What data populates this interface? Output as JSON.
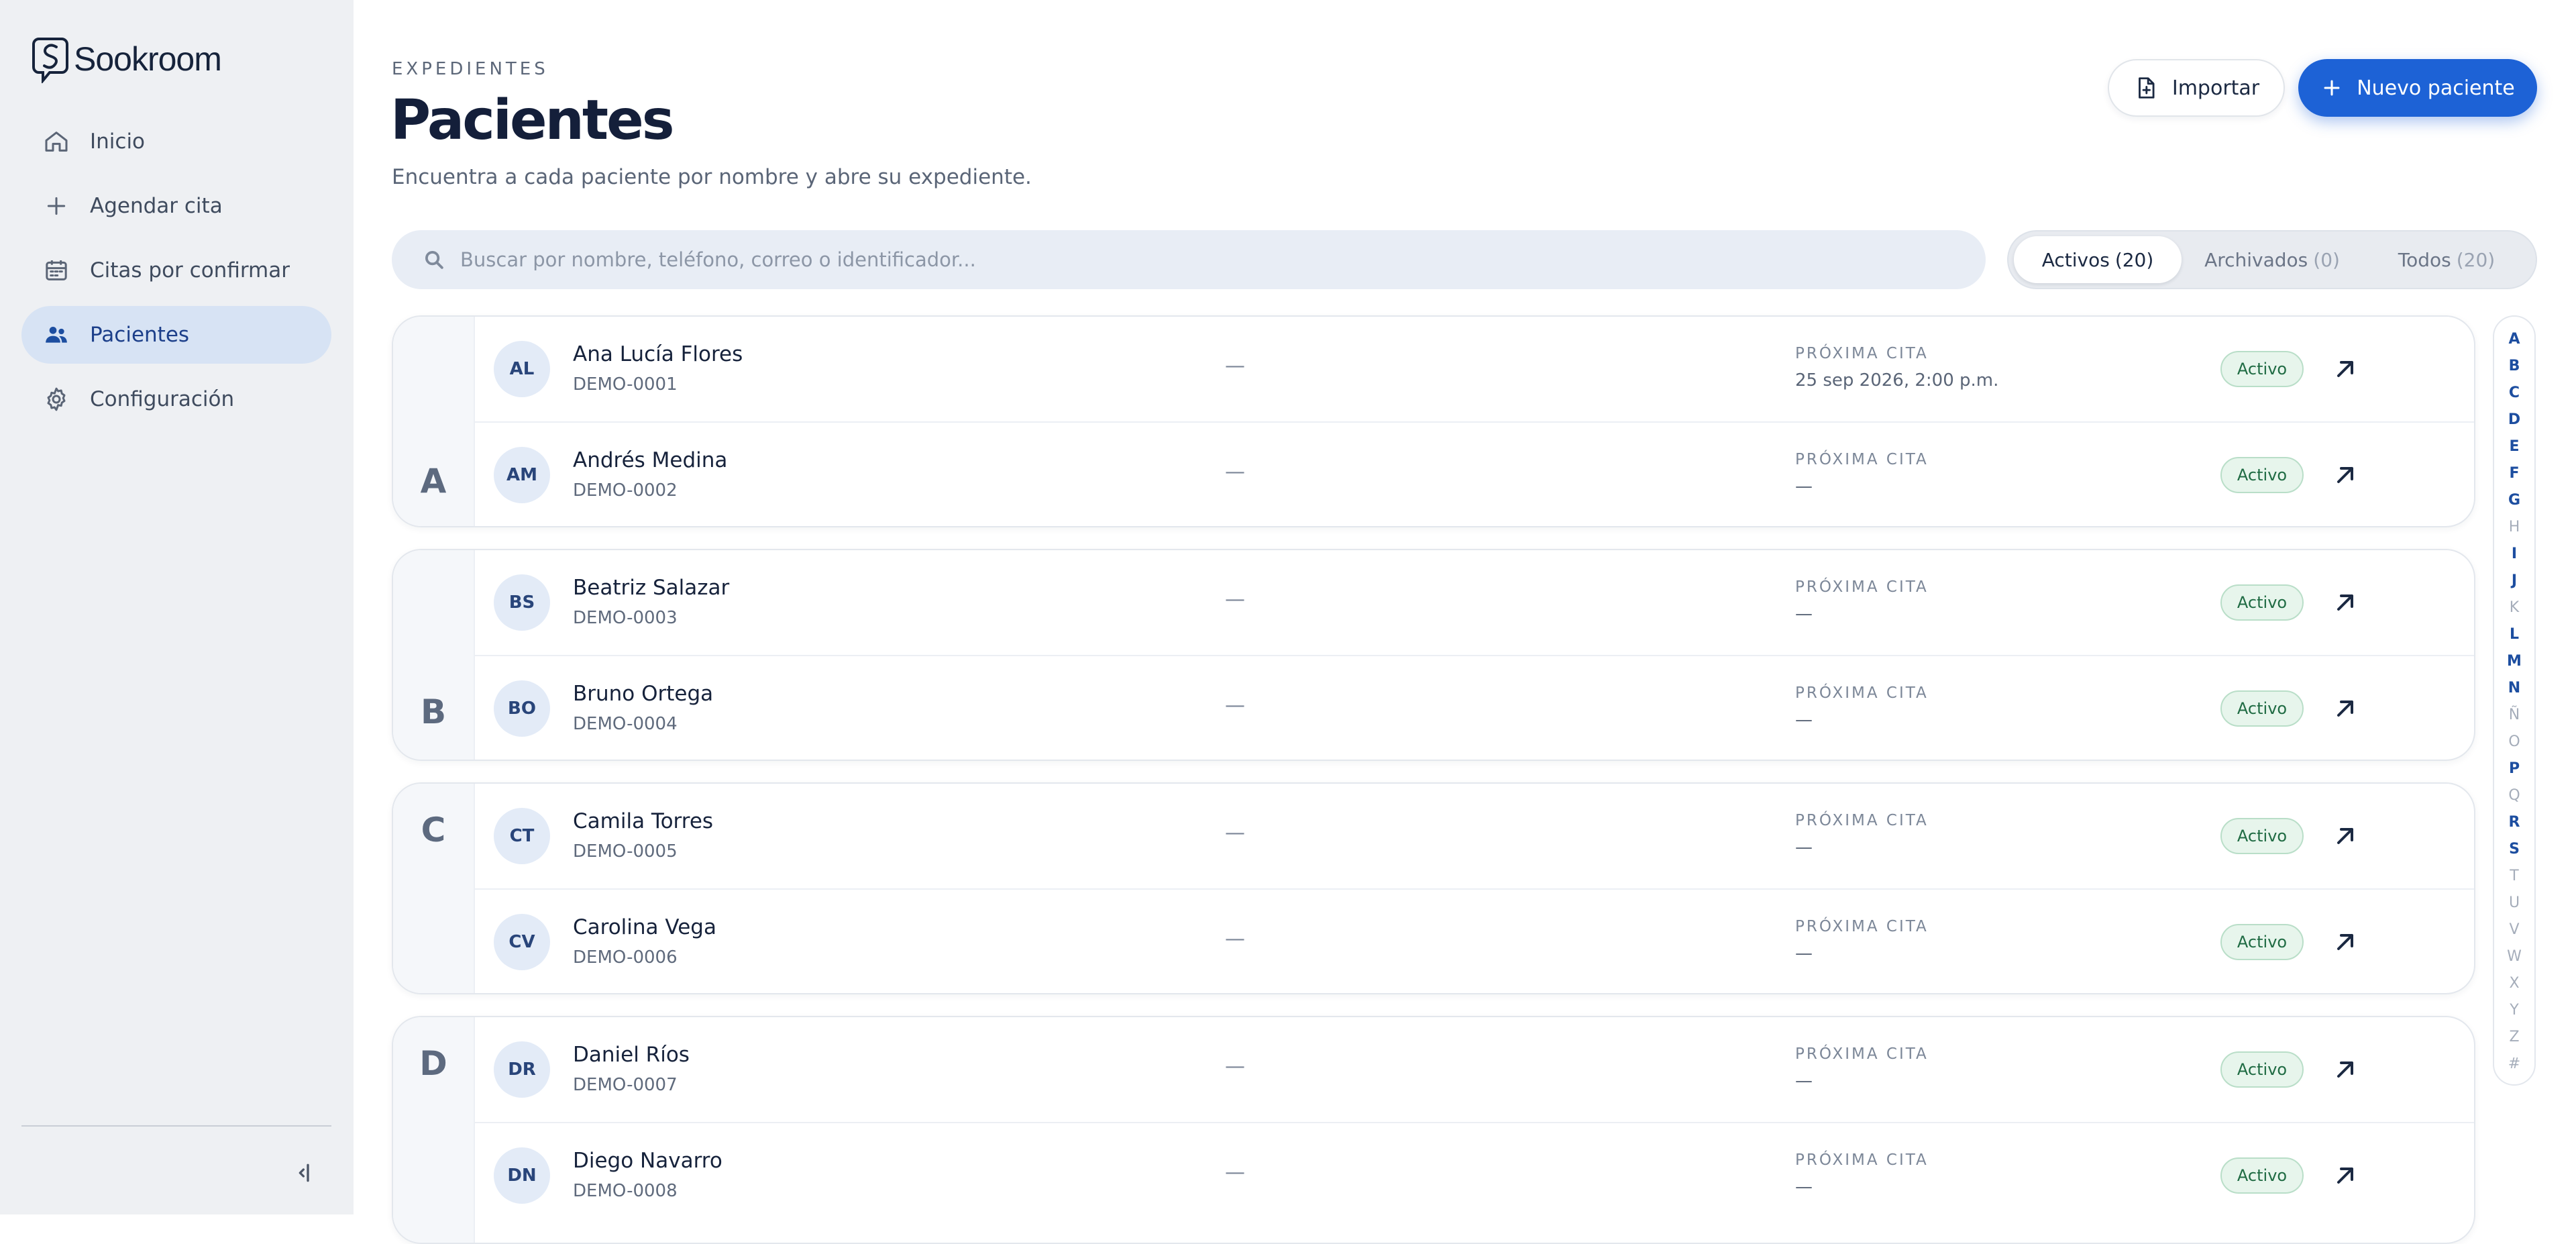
{
  "brand": {
    "name": "Sookroom"
  },
  "sidebar": {
    "items": [
      {
        "label": "Inicio",
        "icon": "home-icon"
      },
      {
        "label": "Agendar cita",
        "icon": "plus-icon"
      },
      {
        "label": "Citas por confirmar",
        "icon": "calendar-icon"
      },
      {
        "label": "Pacientes",
        "icon": "users-icon",
        "active": true
      },
      {
        "label": "Configuración",
        "icon": "gear-icon"
      }
    ]
  },
  "header": {
    "eyebrow": "EXPEDIENTES",
    "title": "Pacientes",
    "subtitle": "Encuentra a cada paciente por nombre y abre su expediente.",
    "import_label": "Importar",
    "new_label": "Nuevo paciente"
  },
  "search": {
    "placeholder": "Buscar por nombre, teléfono, correo o identificador..."
  },
  "filters": [
    {
      "label": "Activos",
      "count": "(20)",
      "active": true
    },
    {
      "label": "Archivados",
      "count": "(0)"
    },
    {
      "label": "Todos",
      "count": "(20)"
    }
  ],
  "row_labels": {
    "next": "PRÓXIMA CITA",
    "status": "Activo",
    "empty": "—"
  },
  "groups": [
    {
      "letter": "A",
      "patients": [
        {
          "initials": "AL",
          "name": "Ana Lucía Flores",
          "id": "DEMO-0001",
          "next": "25 sep 2026, 2:00 p.m."
        },
        {
          "initials": "AM",
          "name": "Andrés Medina",
          "id": "DEMO-0002",
          "next": "—"
        }
      ]
    },
    {
      "letter": "B",
      "patients": [
        {
          "initials": "BS",
          "name": "Beatriz Salazar",
          "id": "DEMO-0003",
          "next": "—"
        },
        {
          "initials": "BO",
          "name": "Bruno Ortega",
          "id": "DEMO-0004",
          "next": "—"
        }
      ]
    },
    {
      "letter": "C",
      "patients": [
        {
          "initials": "CT",
          "name": "Camila Torres",
          "id": "DEMO-0005",
          "next": "—"
        },
        {
          "initials": "CV",
          "name": "Carolina Vega",
          "id": "DEMO-0006",
          "next": "—"
        }
      ]
    },
    {
      "letter": "D",
      "patients": [
        {
          "initials": "DR",
          "name": "Daniel Ríos",
          "id": "DEMO-0007",
          "next": "—"
        },
        {
          "initials": "DN",
          "name": "Diego Navarro",
          "id": "DEMO-0008",
          "next": "—"
        }
      ]
    }
  ],
  "alphabet": [
    {
      "l": "A",
      "on": true
    },
    {
      "l": "B",
      "on": true
    },
    {
      "l": "C",
      "on": true
    },
    {
      "l": "D",
      "on": true
    },
    {
      "l": "E",
      "on": true
    },
    {
      "l": "F",
      "on": true
    },
    {
      "l": "G",
      "on": true
    },
    {
      "l": "H",
      "on": false
    },
    {
      "l": "I",
      "on": true
    },
    {
      "l": "J",
      "on": true
    },
    {
      "l": "K",
      "on": false
    },
    {
      "l": "L",
      "on": true
    },
    {
      "l": "M",
      "on": true
    },
    {
      "l": "N",
      "on": true
    },
    {
      "l": "Ñ",
      "on": false
    },
    {
      "l": "O",
      "on": false
    },
    {
      "l": "P",
      "on": true
    },
    {
      "l": "Q",
      "on": false
    },
    {
      "l": "R",
      "on": true
    },
    {
      "l": "S",
      "on": true
    },
    {
      "l": "T",
      "on": false
    },
    {
      "l": "U",
      "on": false
    },
    {
      "l": "V",
      "on": false
    },
    {
      "l": "W",
      "on": false
    },
    {
      "l": "X",
      "on": false
    },
    {
      "l": "Y",
      "on": false
    },
    {
      "l": "Z",
      "on": false
    },
    {
      "l": "#",
      "on": false
    }
  ],
  "colors": {
    "accent": "#1d62d6",
    "active_nav_bg": "#d7e3f4",
    "badge_bg": "#e7f5ec",
    "badge_text": "#1f6b43"
  }
}
